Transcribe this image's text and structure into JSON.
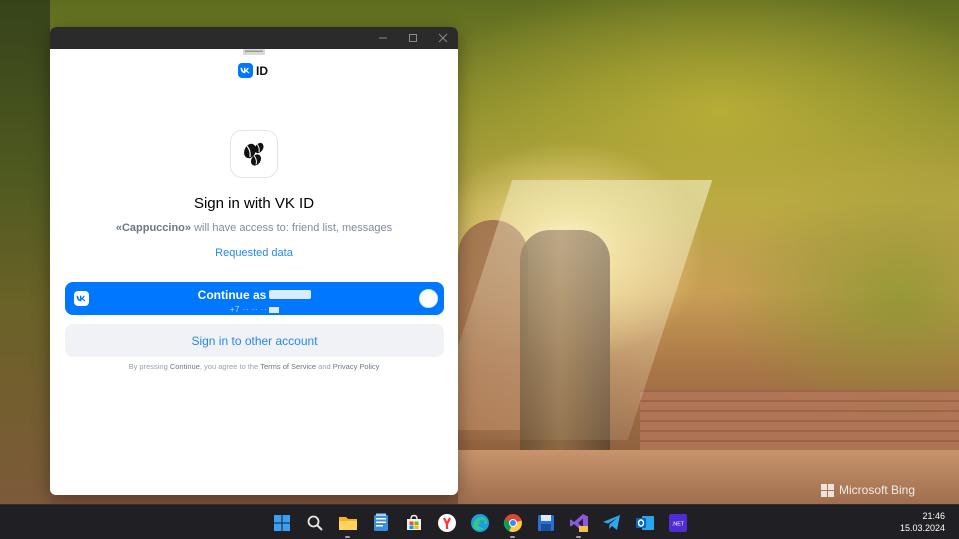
{
  "window": {
    "controls": [
      "minimize",
      "maximize",
      "close"
    ]
  },
  "vkid": {
    "logo_text": "ID"
  },
  "dialog": {
    "title": "Sign in with VK ID",
    "app_name": "«Cappuccino»",
    "access_text": " will have access to: friend list, messages",
    "requested_link": "Requested data",
    "continue_label": "Continue as",
    "phone_masked": "+7 ·· ·· ··",
    "other_account_label": "Sign in to other account",
    "terms": {
      "prefix": "By pressing ",
      "continue_word": "Continue",
      "middle": ", you agree to the ",
      "terms_link": "Terms of Service",
      "and": " and ",
      "privacy_link": "Privacy Policy"
    }
  },
  "desktop": {
    "watermark": "Microsoft Bing"
  },
  "taskbar": {
    "icons": [
      "windows-start-icon",
      "search-icon",
      "file-explorer-icon",
      "notepad-icon",
      "microsoft-store-icon",
      "yandex-browser-icon",
      "edge-icon",
      "chrome-icon",
      "save-disk-icon",
      "visual-studio-icon",
      "telegram-icon",
      "outlook-icon",
      "dotnet-icon"
    ],
    "time": "21:46",
    "date": "15.03.2024"
  },
  "colors": {
    "vk_blue": "#0077ff",
    "link_blue": "#2688eb",
    "secondary_button": "#f0f2f5",
    "taskbar": "#1f1f24"
  }
}
